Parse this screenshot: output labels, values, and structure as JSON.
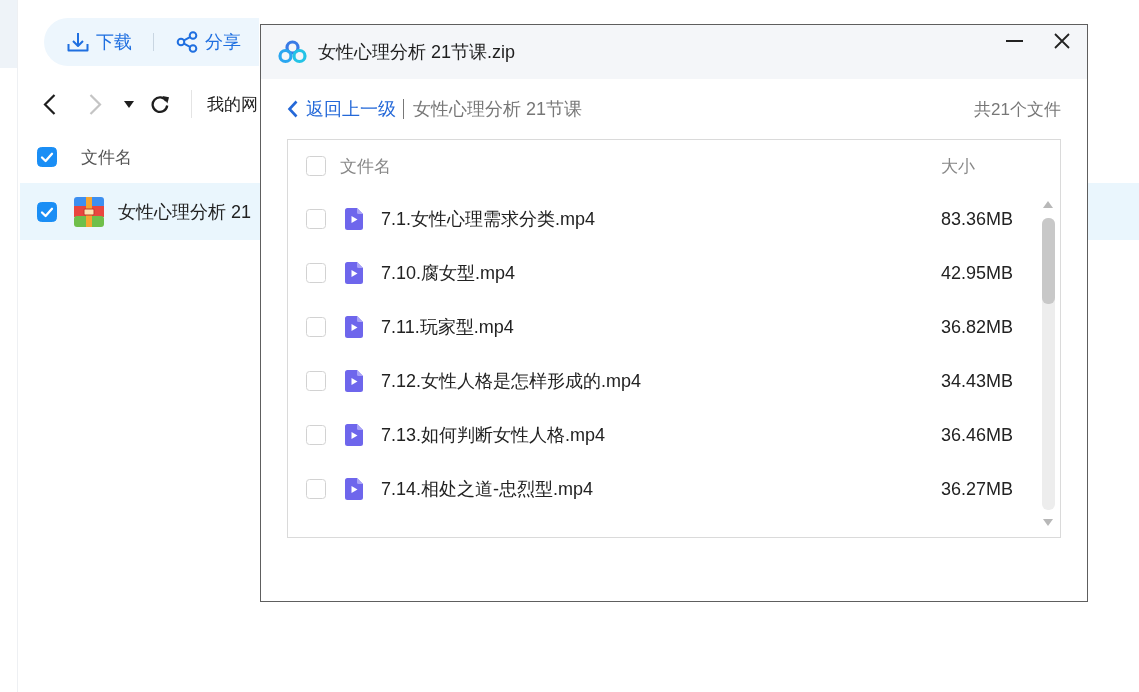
{
  "toolbar": {
    "buttons": [
      {
        "kind": "download",
        "label": "下载"
      },
      {
        "kind": "share",
        "label": "分享"
      }
    ]
  },
  "navigation": {
    "buttons": [
      {
        "kind": "back",
        "disabled": false
      },
      {
        "kind": "forward",
        "disabled": true
      },
      {
        "kind": "dropdown",
        "disabled": false
      },
      {
        "kind": "refresh",
        "disabled": false
      }
    ],
    "path": "我的网"
  },
  "file_list": {
    "columns": [
      "文件名"
    ],
    "all_checked": true,
    "rows": [
      {
        "name": "女性心理分析 21",
        "checked": true,
        "selected": true
      }
    ]
  },
  "dialog": {
    "title": "女性心理分析 21节课.zip",
    "back_link": "返回上一级",
    "current_folder": "女性心理分析 21节课",
    "file_count": "共21个文件",
    "all_checked": false,
    "columns": [
      "文件名",
      "大小"
    ],
    "files": [
      {
        "name": "7.1.女性心理需求分类.mp4",
        "size": "83.36MB",
        "checked": false
      },
      {
        "name": "7.10.腐女型.mp4",
        "size": "42.95MB",
        "checked": false
      },
      {
        "name": "7.11.玩家型.mp4",
        "size": "36.82MB",
        "checked": false
      },
      {
        "name": "7.12.女性人格是怎样形成的.mp4",
        "size": "34.43MB",
        "checked": false
      },
      {
        "name": "7.13.如何判断女性人格.mp4",
        "size": "36.46MB",
        "checked": false
      },
      {
        "name": "7.14.相处之道-忠烈型.mp4",
        "size": "36.27MB",
        "checked": false
      }
    ]
  }
}
